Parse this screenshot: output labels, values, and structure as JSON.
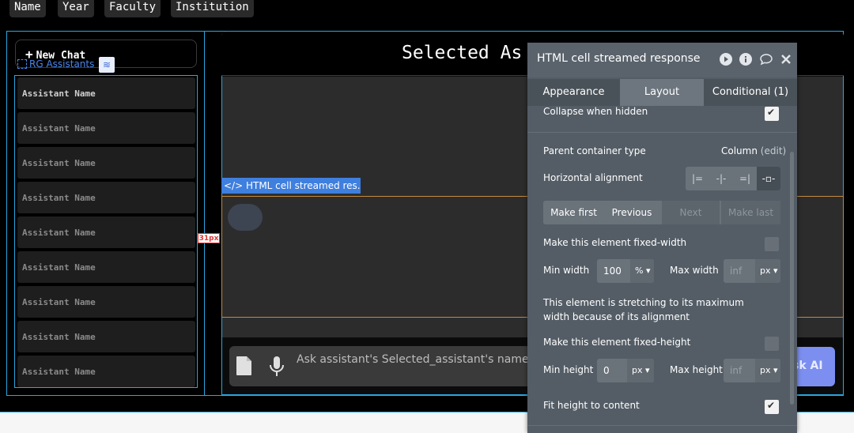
{
  "top_tabs": [
    "Name",
    "Year",
    "Faculty",
    "Institution"
  ],
  "sidebar": {
    "new_chat_label": "New Chat",
    "repeating_group_label": "RG Assistants",
    "items": [
      "Assistant Name",
      "Assistant Name",
      "Assistant Name",
      "Assistant Name",
      "Assistant Name",
      "Assistant Name",
      "Assistant Name",
      "Assistant Name",
      "Assistant Name"
    ]
  },
  "main": {
    "title": "Selected As",
    "selected_element_tag": "</> HTML cell streamed res...",
    "spacing_badge": "31px",
    "input_placeholder": "Ask assistant's Selected_assistant's name's Ass",
    "ask_button_label": "sk AI"
  },
  "property_panel": {
    "title": "HTML cell streamed response",
    "tabs": [
      "Appearance",
      "Layout",
      "Conditional (1)"
    ],
    "active_tab": "Layout",
    "collapse_when_hidden": {
      "label": "Collapse when hidden",
      "checked": true
    },
    "parent_container_type": {
      "label": "Parent container type",
      "value": "Column",
      "edit": "(edit)"
    },
    "horizontal_alignment": {
      "label": "Horizontal alignment"
    },
    "order_buttons": [
      "Make first",
      "Previous",
      "Next",
      "Make last"
    ],
    "fixed_width": {
      "label": "Make this element fixed-width",
      "checked": false
    },
    "min_width": {
      "label": "Min width",
      "value": "100",
      "unit": "%"
    },
    "max_width": {
      "label": "Max width",
      "value": "inf",
      "unit": "px"
    },
    "stretch_note": "This element is stretching to its maximum width because of its alignment",
    "fixed_height": {
      "label": "Make this element fixed-height",
      "checked": false
    },
    "min_height": {
      "label": "Min height",
      "value": "0",
      "unit": "px"
    },
    "max_height": {
      "label": "Max height",
      "value": "inf",
      "unit": "px"
    },
    "fit_height": {
      "label": "Fit height to content",
      "checked": true
    }
  },
  "colors": {
    "accent_blue": "#2aa7e0",
    "selection_orange": "#c28a3f",
    "ask_button": "#7c8ff0",
    "panel_bg": "#545d66"
  }
}
